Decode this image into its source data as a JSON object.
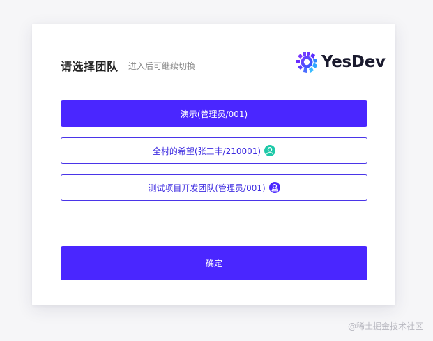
{
  "dialog": {
    "title": "请选择团队",
    "subtitle": "进入后可继续切换",
    "logo_text": "YesDev"
  },
  "teams": [
    {
      "label": "演示(管理员/001)",
      "selected": true,
      "badge": ""
    },
    {
      "label": "全村的希望(张三丰/210001)",
      "selected": false,
      "badge": "user-icon",
      "badge_color": "#1ec9a8"
    },
    {
      "label": "测试项目开发团队(管理员/001)",
      "selected": false,
      "badge": "admin-user-icon",
      "badge_color": "#4a26ff"
    }
  ],
  "confirm_label": "确定",
  "watermark": "@稀土掘金技术社区",
  "colors": {
    "accent": "#4a26ff",
    "teal_badge": "#1ec9a8",
    "background": "#f6f6f8"
  }
}
